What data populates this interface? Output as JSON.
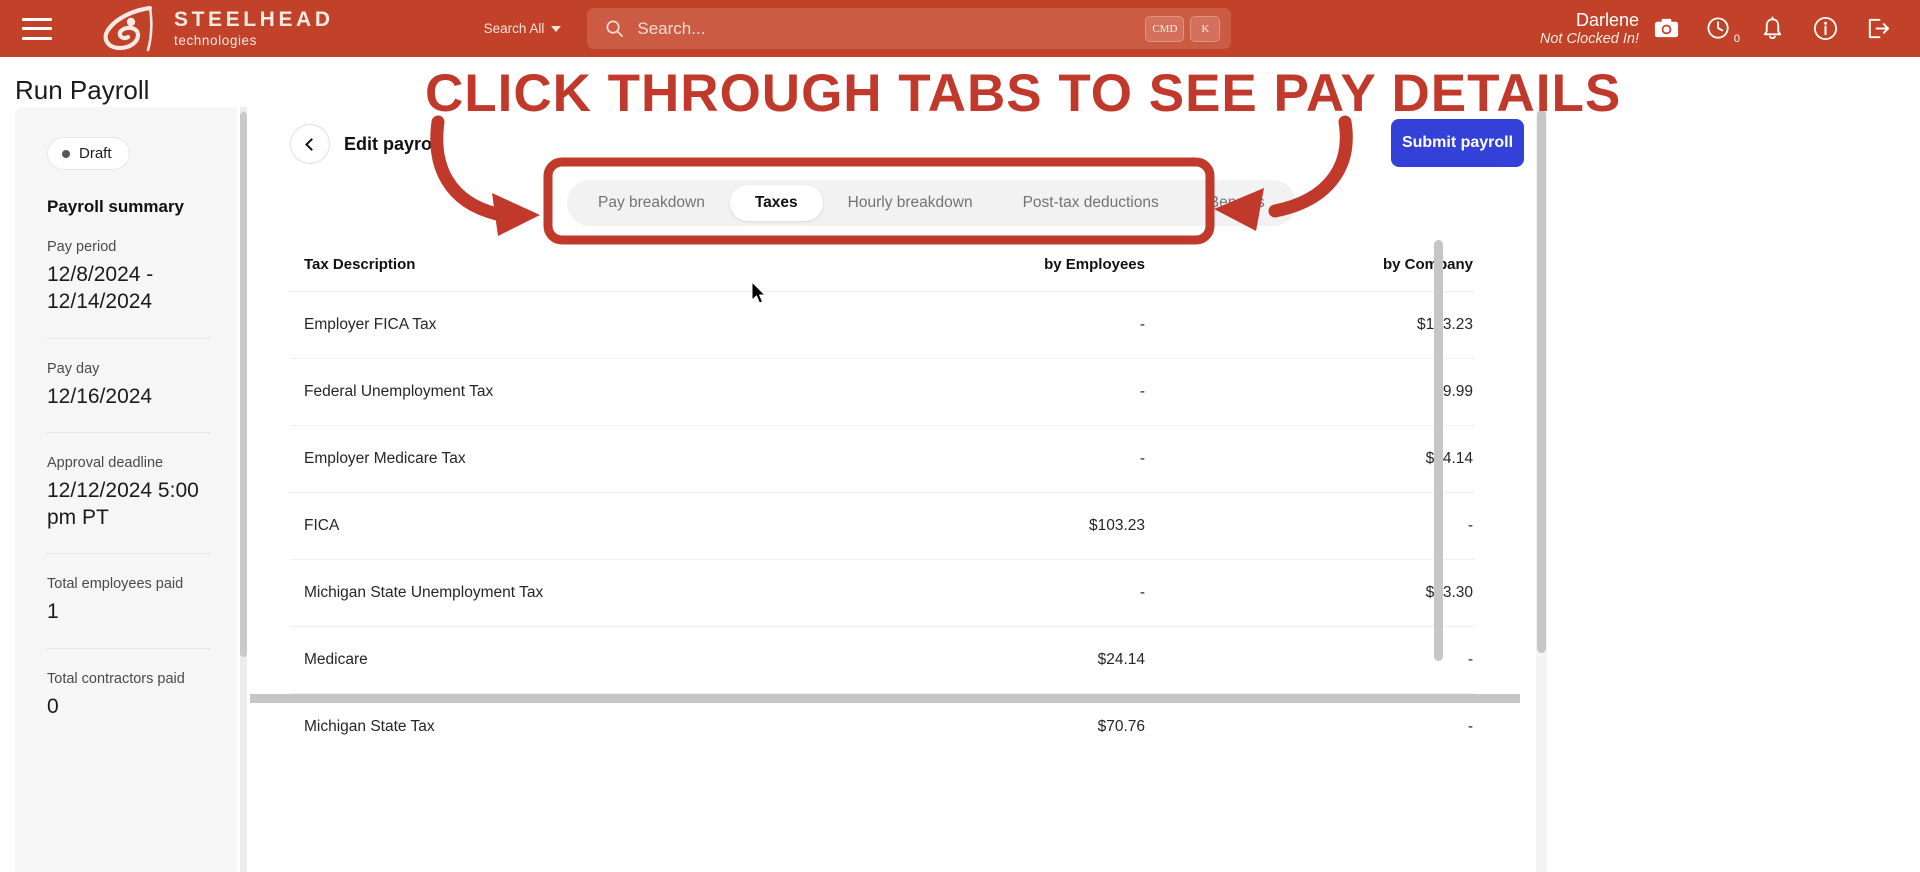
{
  "topbar": {
    "menu_icon": "hamburger-icon",
    "brand_name": "STEELHEAD",
    "brand_sub": "technologies",
    "search_scope": "Search All",
    "search_placeholder": "Search...",
    "kbd_cmd": "CMD",
    "kbd_k": "K",
    "user_name": "Darlene",
    "user_status": "Not Clocked In!",
    "clock_badge": "0",
    "icons": [
      "camera-icon",
      "clock-icon",
      "bell-icon",
      "info-icon",
      "logout-icon"
    ],
    "bg_color": "#C14228"
  },
  "page": {
    "title": "Run Payroll"
  },
  "summary": {
    "status_badge": "Draft",
    "heading": "Payroll summary",
    "fields": [
      {
        "label": "Pay period",
        "value": "12/8/2024 - 12/14/2024"
      },
      {
        "label": "Pay day",
        "value": "12/16/2024"
      },
      {
        "label": "Approval deadline",
        "value": "12/12/2024 5:00 pm PT"
      },
      {
        "label": "Total employees paid",
        "value": "1"
      },
      {
        "label": "Total contractors paid",
        "value": "0"
      }
    ]
  },
  "main": {
    "back_label": "Edit payroll",
    "submit_label": "Submit payroll",
    "submit_color": "#3341D8",
    "tabs": [
      {
        "label": "Pay breakdown",
        "active": false
      },
      {
        "label": "Taxes",
        "active": true
      },
      {
        "label": "Hourly breakdown",
        "active": false
      },
      {
        "label": "Post-tax deductions",
        "active": false
      },
      {
        "label": "Benefits",
        "active": false
      }
    ],
    "table": {
      "columns": [
        "Tax Description",
        "by Employees",
        "by Company"
      ],
      "rows": [
        {
          "description": "Employer FICA Tax",
          "by_employees": "-",
          "by_company": "$103.23"
        },
        {
          "description": "Federal Unemployment Tax",
          "by_employees": "-",
          "by_company": "$9.99"
        },
        {
          "description": "Employer Medicare Tax",
          "by_employees": "-",
          "by_company": "$24.14"
        },
        {
          "description": "FICA",
          "by_employees": "$103.23",
          "by_company": "-"
        },
        {
          "description": "Michigan State Unemployment Tax",
          "by_employees": "-",
          "by_company": "$33.30"
        },
        {
          "description": "Medicare",
          "by_employees": "$24.14",
          "by_company": "-"
        },
        {
          "description": "Michigan State Tax",
          "by_employees": "$70.76",
          "by_company": "-"
        }
      ]
    }
  },
  "annotation": {
    "text": "CLICK THROUGH TABS TO SEE PAY DETAILS",
    "color": "#C0392B"
  }
}
